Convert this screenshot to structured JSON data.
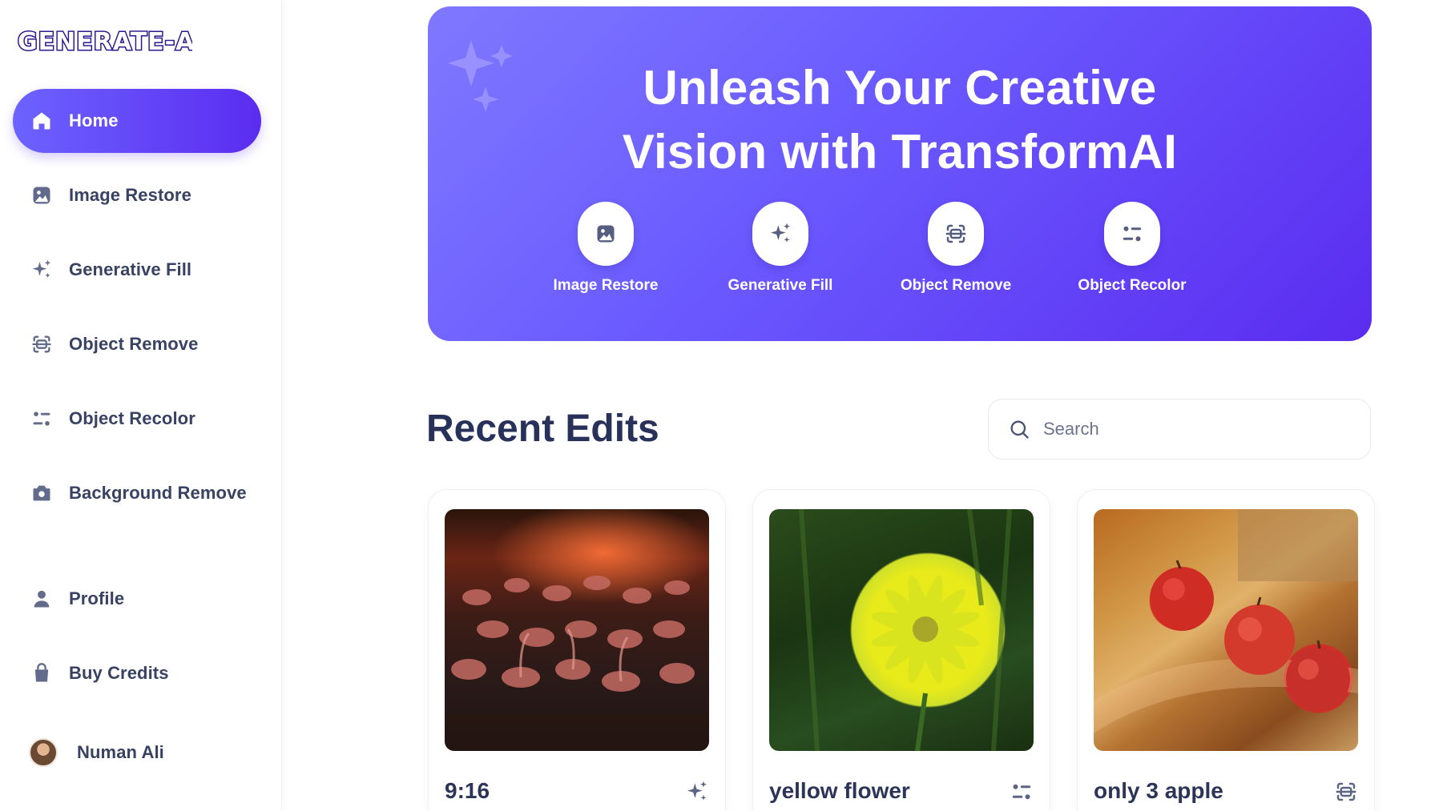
{
  "brand": {
    "logo_text": "GENERATE-AI"
  },
  "sidebar": {
    "items": [
      {
        "label": "Home",
        "icon": "home-icon",
        "active": true
      },
      {
        "label": "Image Restore",
        "icon": "image-icon"
      },
      {
        "label": "Generative Fill",
        "icon": "sparkles-icon"
      },
      {
        "label": "Object Remove",
        "icon": "scan-icon"
      },
      {
        "label": "Object Recolor",
        "icon": "filter-icon"
      },
      {
        "label": "Background Remove",
        "icon": "camera-icon"
      }
    ],
    "bottom": [
      {
        "label": "Profile",
        "icon": "user-icon"
      },
      {
        "label": "Buy Credits",
        "icon": "bag-icon"
      }
    ],
    "user": {
      "name": "Numan Ali",
      "icon": "avatar"
    }
  },
  "hero": {
    "title_line1": "Unleash Your Creative",
    "title_line2": "Vision with TransformAI",
    "tools": [
      {
        "label": "Image Restore",
        "icon": "image-icon"
      },
      {
        "label": "Generative Fill",
        "icon": "sparkles-icon"
      },
      {
        "label": "Object Remove",
        "icon": "scan-icon"
      },
      {
        "label": "Object Recolor",
        "icon": "filter-icon"
      }
    ]
  },
  "recent": {
    "title": "Recent Edits",
    "search_placeholder": "Search",
    "cards": [
      {
        "title": "9:16",
        "icon": "sparkles-icon",
        "image": "flamingos"
      },
      {
        "title": "yellow flower",
        "icon": "filter-icon",
        "image": "yellow-dahlia"
      },
      {
        "title": "only 3 apple",
        "icon": "scan-icon",
        "image": "apples-on-bread"
      }
    ]
  },
  "colors": {
    "accent": "#5b2cf0",
    "accent_light": "#7f78ff",
    "text": "#384262",
    "heading": "#27315a"
  }
}
